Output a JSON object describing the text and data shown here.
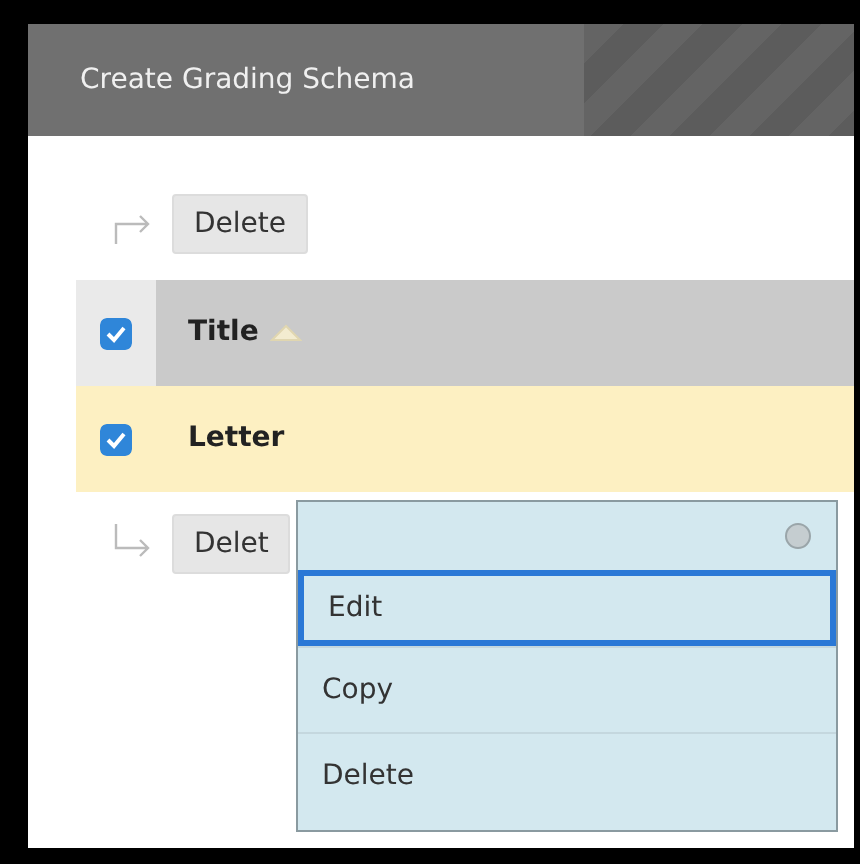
{
  "header": {
    "title": "Create Grading Schema"
  },
  "top_action": {
    "label": "Delete"
  },
  "rows": [
    {
      "label": "Title",
      "kind": "header",
      "checked": true,
      "sorted": true
    },
    {
      "label": "Letter",
      "kind": "item",
      "checked": true,
      "sorted": false
    }
  ],
  "bottom_action": {
    "label": "Delet"
  },
  "menu": {
    "items": [
      {
        "label": "Edit",
        "selected": true
      },
      {
        "label": "Copy",
        "selected": false
      },
      {
        "label": "Delete",
        "selected": false
      }
    ]
  }
}
